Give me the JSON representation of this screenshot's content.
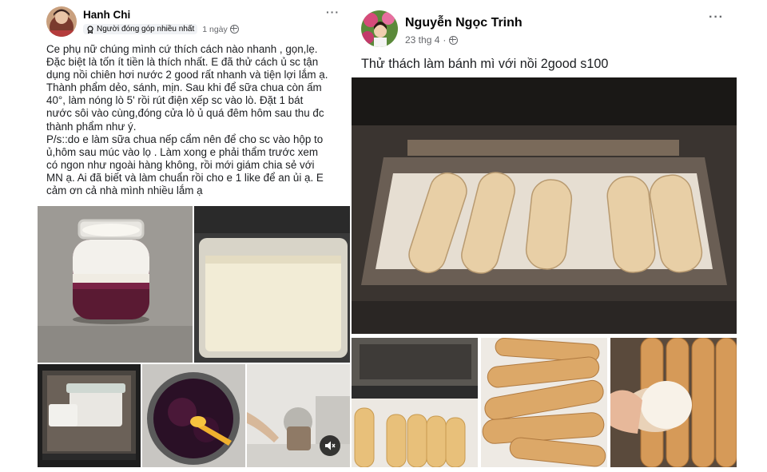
{
  "post_left": {
    "author": "Hanh Chi",
    "badge": "Người đóng góp nhiều nhất",
    "time": "1 ngày",
    "more": "···",
    "text": "Ce phụ nữ chúng mình cứ thích cách nào nhanh , gọn,lẹ.\nĐặc biệt là tốn ít tiền là thích nhất. E đã thử cách ủ sc tận\ndụng nồi chiên hơi nước 2 good rất nhanh và tiện lợi lắm ạ.\nThành phẩm dẻo, sánh, mịn. Sau khi để sữa chua còn ấm\n40°, làm nóng lò 5' rồi rút điện xếp sc vào lò. Đặt 1 bát\nnước sôi vào cùng,đóng cửa lò ủ quá đêm hôm sau thu đc\nthành phẩm như ý.\nP/s::do e làm sữa chua nếp cẩm nên để cho sc vào hộp to\nủ,hôm sau múc vào lọ . Làm xong e phải thẩm trước xem\ncó ngon như ngoài hàng không, rồi mới giám chia sẻ với\nMN ạ. Ai đã biết và làm chuẩn rồi cho e 1 like để an ủi ạ. E\ncảm ơn cả nhà mình nhiều lắm ạ",
    "photos": [
      "yogurt-jar-photo",
      "yogurt-tray-photo",
      "oven-boxes-photo",
      "black-rice-pot-photo",
      "kitchen-video-thumbnail"
    ],
    "video_muted_icon": "speaker-muted-icon"
  },
  "post_right": {
    "author": "Nguyễn Ngọc Trinh",
    "time": "23 thg 4",
    "separator": "·",
    "more": "···",
    "text": "Thử thách làm bánh mì với nồi 2good s100",
    "photos": [
      "oven-baguettes-photo",
      "baguette-tray-photo",
      "baked-baguettes-photo",
      "broken-baguette-photo"
    ]
  },
  "colors": {
    "accent_text": "#050505",
    "secondary_text": "#65676b",
    "badge_bg": "#f0f2f5"
  }
}
